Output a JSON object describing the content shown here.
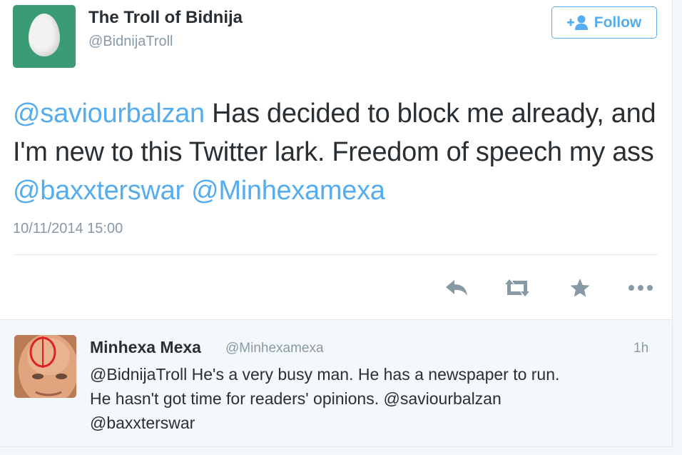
{
  "tweet": {
    "author_name": "The Troll of Bidnija",
    "author_handle": "@BidnijaTroll",
    "follow_label": "Follow",
    "mention_1": "@saviourbalzan",
    "text_1": " Has decided to block me already, and I'm new to this Twitter lark.  Freedom of speech my ass ",
    "mention_2": "@baxxterswar",
    "mention_3": "@Minhexamexa",
    "timestamp": "10/11/2014 15:00"
  },
  "actions": {
    "reply_icon": "reply-icon",
    "retweet_icon": "retweet-icon",
    "favorite_icon": "star-icon",
    "more_icon": "more-icon"
  },
  "reply": {
    "author_name": "Minhexa Mexa",
    "author_handle": "@Minhexamexa",
    "time": "1h",
    "line_1": "@BidnijaTroll He's a very busy man. He has a newspaper to run.",
    "line_2": "He hasn't got time for readers' opinions. @saviourbalzan",
    "line_3": "@baxxterswar"
  },
  "colors": {
    "accent": "#55acee",
    "egg_background": "#3b9b75",
    "text": "#292f33",
    "muted": "#8899a6"
  }
}
